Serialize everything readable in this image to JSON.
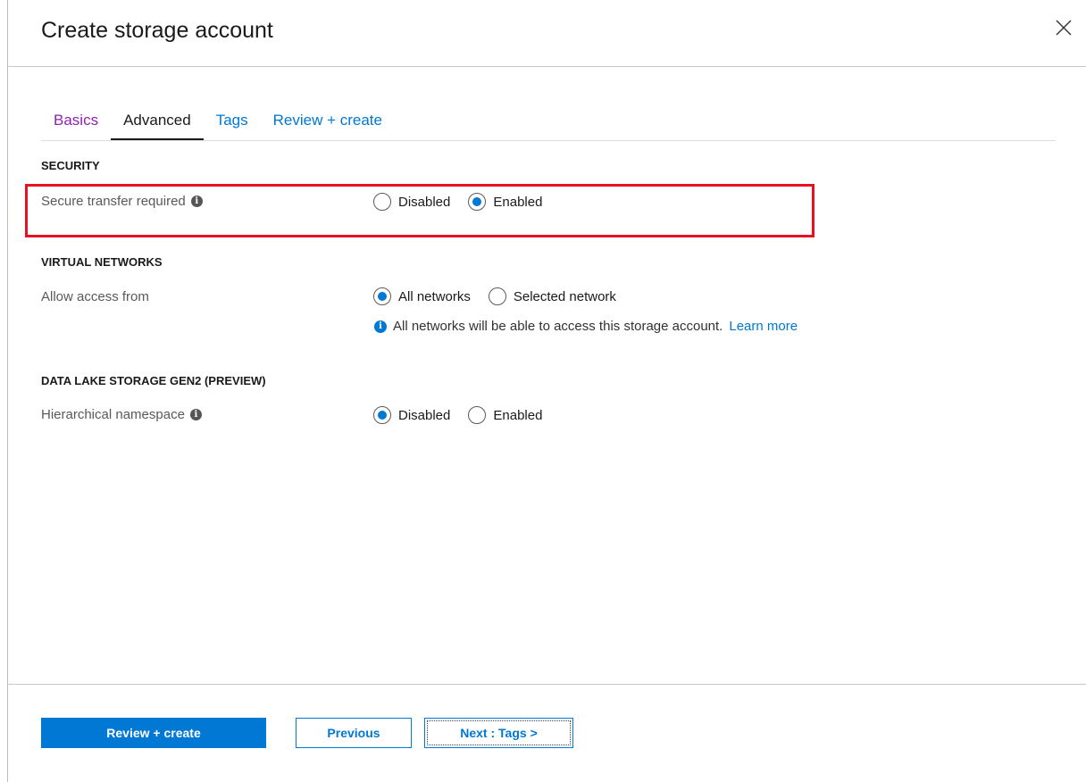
{
  "header": {
    "title": "Create storage account"
  },
  "tabs": [
    {
      "label": "Basics",
      "state": "visited"
    },
    {
      "label": "Advanced",
      "state": "active"
    },
    {
      "label": "Tags",
      "state": "default"
    },
    {
      "label": "Review + create",
      "state": "default"
    }
  ],
  "security": {
    "title": "SECURITY",
    "secure_transfer": {
      "label": "Secure transfer required",
      "options": [
        "Disabled",
        "Enabled"
      ],
      "selected": "Enabled"
    }
  },
  "virtual_networks": {
    "title": "VIRTUAL NETWORKS",
    "allow_access": {
      "label": "Allow access from",
      "options": [
        "All networks",
        "Selected network"
      ],
      "selected": "All networks"
    },
    "info_text": "All networks will be able to access this storage account.",
    "learn_more": "Learn more"
  },
  "data_lake": {
    "title": "DATA LAKE STORAGE GEN2 (PREVIEW)",
    "hierarchical_namespace": {
      "label": "Hierarchical namespace",
      "options": [
        "Disabled",
        "Enabled"
      ],
      "selected": "Disabled"
    }
  },
  "footer": {
    "review_create": "Review + create",
    "previous": "Previous",
    "next": "Next : Tags >"
  },
  "colors": {
    "accent": "#0078d4",
    "highlight": "#e81123",
    "visited_tab": "#8e24aa"
  }
}
